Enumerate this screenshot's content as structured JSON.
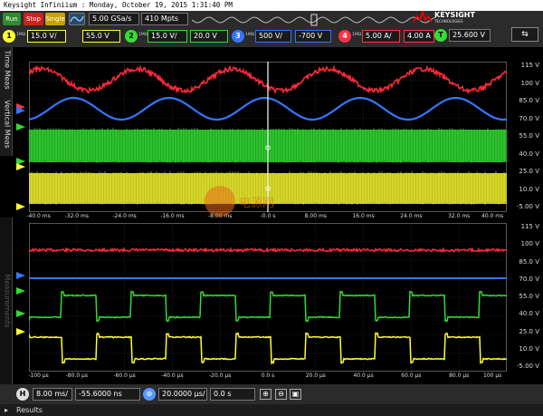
{
  "window": {
    "title": "Keysight Infiniium : Monday, October 19, 2015 1:31:40 PM"
  },
  "brand": {
    "name": "KEYSIGHT",
    "sub": "TECHNOLOGIES"
  },
  "controls": {
    "run_label": "Run",
    "stop_label": "Stop",
    "single_label": "Single",
    "sample_rate": "5.00 GSa/s",
    "memory_depth": "410 Mpts",
    "trigger_level": "25.600 V"
  },
  "channels": [
    {
      "num": "1",
      "coupling": "1MΩ",
      "scale": "15.0 V/",
      "offset": "55.0 V",
      "color": "#ffff33"
    },
    {
      "num": "2",
      "coupling": "1MΩ",
      "scale": "15.0 V/",
      "offset": "20.0 V",
      "color": "#33dd33"
    },
    {
      "num": "3",
      "coupling": "1MΩ",
      "scale": "500 V/",
      "offset": "-700 V",
      "color": "#3377ff"
    },
    {
      "num": "4",
      "coupling": "1MΩ",
      "scale": "5.00 A/",
      "offset": "4.00 A",
      "color": "#ff3344"
    }
  ],
  "side_tabs": {
    "top": "Time Meas",
    "middle": "Vertical Meas",
    "lower": "Measurements"
  },
  "upper_scale": [
    "115 V",
    "100 V",
    "85.0 V",
    "70.0 V",
    "55.0 V",
    "40.0 V",
    "25.0 V",
    "10.0 V",
    "-5.00 V"
  ],
  "lower_scale": [
    "115 V",
    "100 V",
    "85.0 V",
    "70.0 V",
    "55.0 V",
    "40.0 V",
    "25.0 V",
    "10.0 V",
    "-5.00 V"
  ],
  "upper_time_ticks": [
    "-40.0 ms",
    "-32.0 ms",
    "-24.0 ms",
    "-16.0 ms",
    "-8.00 ms",
    "-0.0 s",
    "8.00 ms",
    "16.0 ms",
    "24.0 ms",
    "32.0 ms",
    "40.0 ms"
  ],
  "lower_time_ticks": [
    "-100 µs",
    "-80.0 µs",
    "-60.0 µs",
    "-40.0 µs",
    "-20.0 µs",
    "0.0 s",
    "20.0 µs",
    "40.0 µs",
    "60.0 µs",
    "80.0 µs",
    "100 µs"
  ],
  "timebase": {
    "main_scale": "8.00 ms/",
    "main_delay": "-55.6000 ns",
    "zoom_scale": "20.0000 µs/",
    "zoom_delay": "0.0 s"
  },
  "results_label": "Results",
  "watermark": "电源网",
  "colors": {
    "ch1": "#ffff33",
    "ch2": "#33dd33",
    "ch3": "#3377ff",
    "ch4": "#ff3344",
    "grid": "#333333"
  }
}
